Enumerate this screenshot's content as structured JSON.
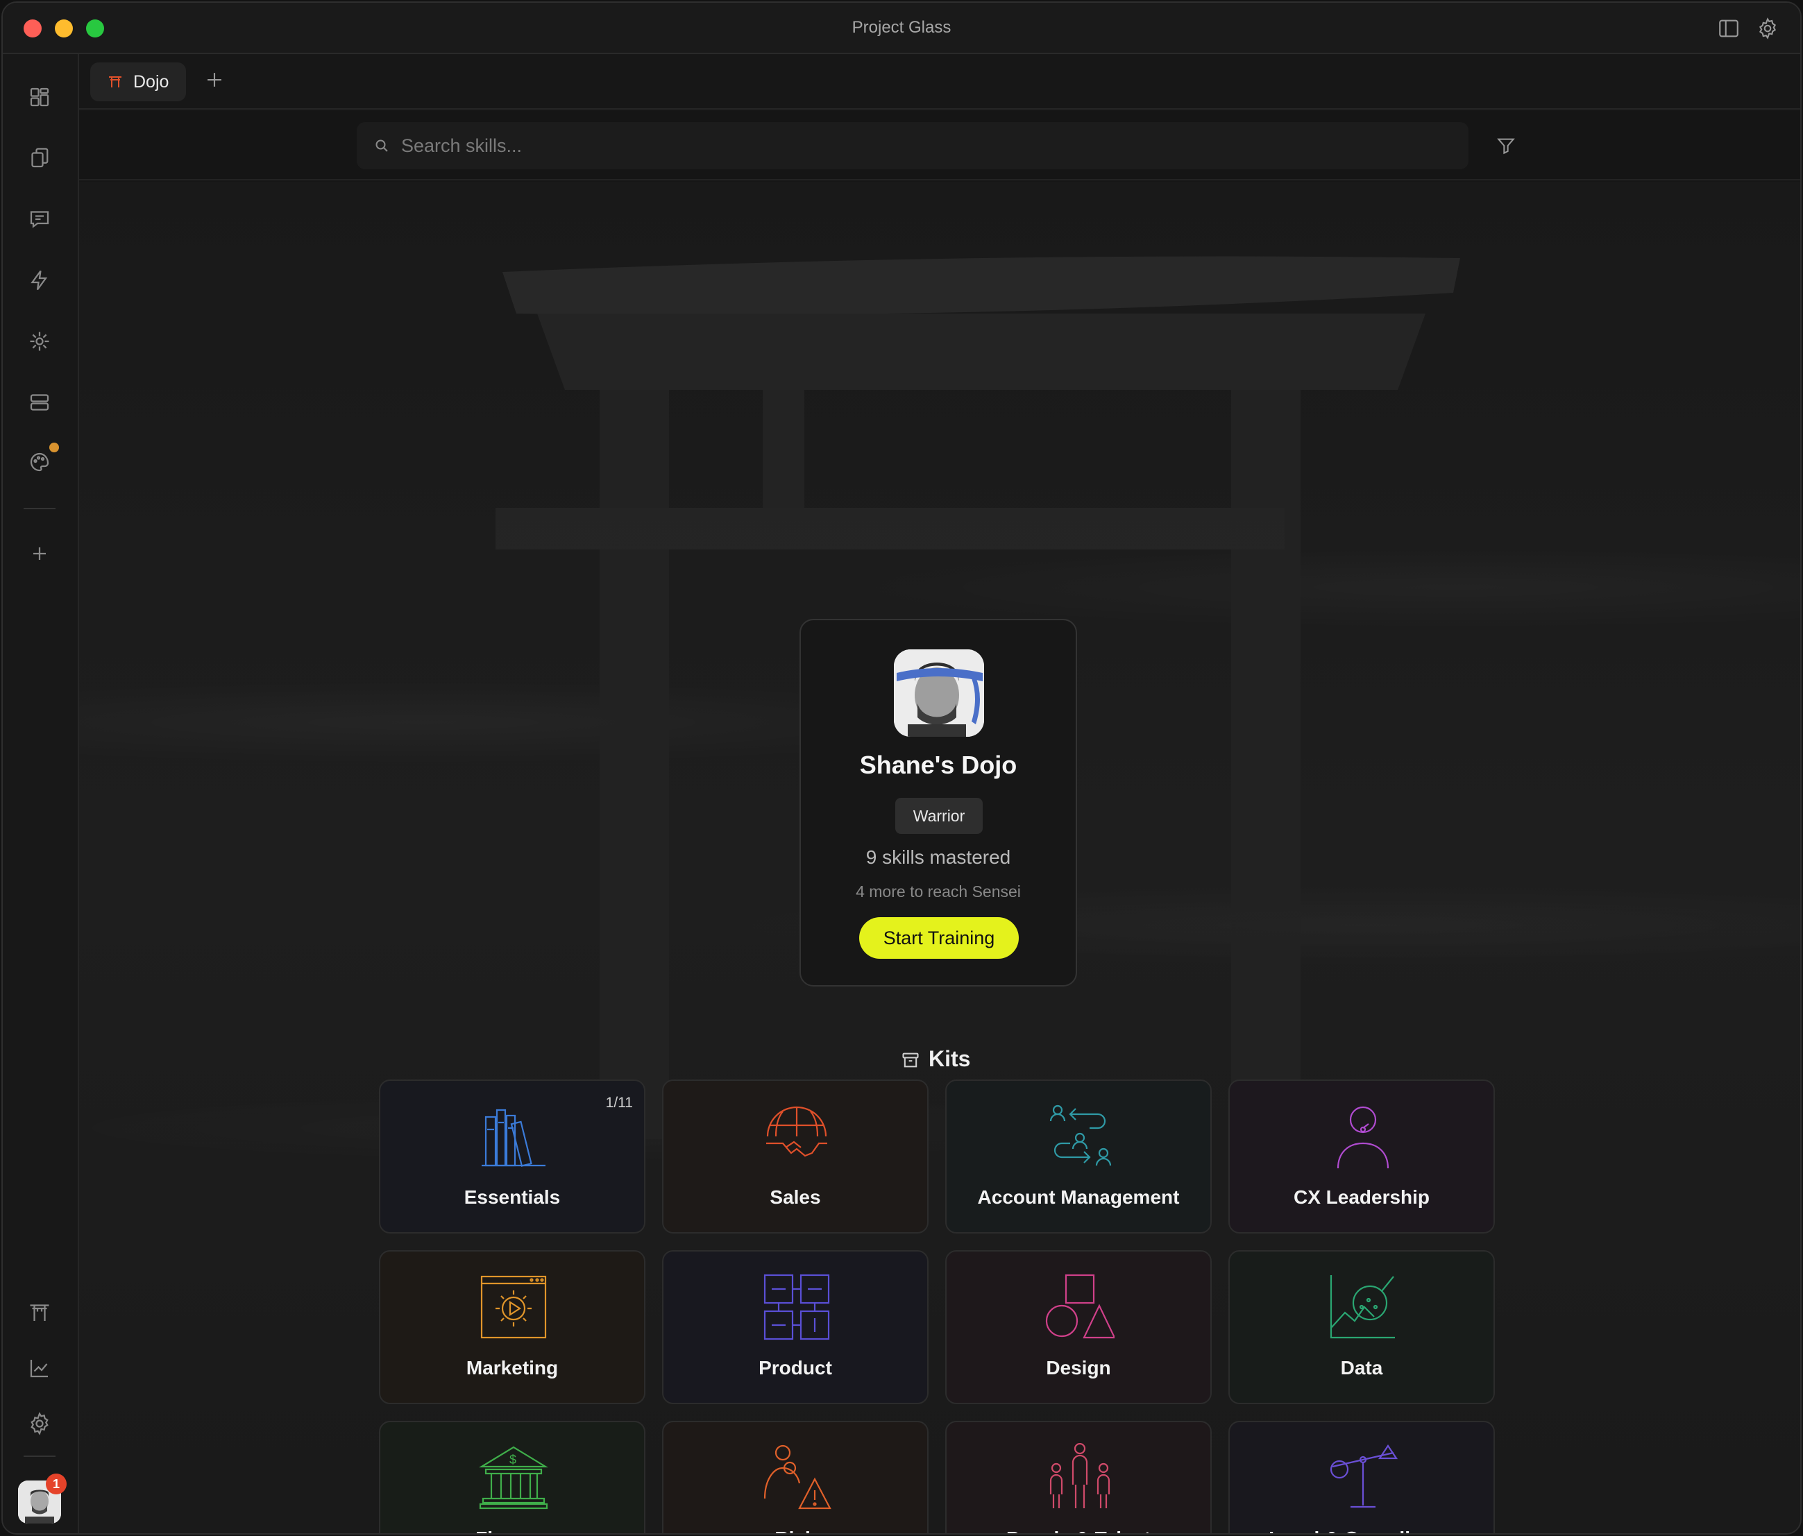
{
  "window": {
    "title": "Project Glass"
  },
  "tabs": [
    {
      "label": "Dojo",
      "icon": "torii-icon"
    }
  ],
  "search": {
    "placeholder": "Search skills..."
  },
  "profile": {
    "name": "Shane's Dojo",
    "rank": "Warrior",
    "skills_mastered": "9 skills mastered",
    "progress_note": "4 more to reach Sensei",
    "cta": "Start Training",
    "cta_color": "#e4f21c"
  },
  "kits": {
    "title": "Kits",
    "items": [
      {
        "label": "Essentials",
        "count": "1/11",
        "icon": "books-icon",
        "color": "#3b7bd8"
      },
      {
        "label": "Sales",
        "icon": "globe-handshake-icon",
        "color": "#e0502a"
      },
      {
        "label": "Account Management",
        "icon": "people-exchange-icon",
        "color": "#2f9aa6"
      },
      {
        "label": "CX Leadership",
        "icon": "headset-person-icon",
        "color": "#b04bd0"
      },
      {
        "label": "Marketing",
        "icon": "video-browser-icon",
        "color": "#e0952a"
      },
      {
        "label": "Product",
        "icon": "blocks-icon",
        "color": "#5a4fd6"
      },
      {
        "label": "Design",
        "icon": "shapes-icon",
        "color": "#d0408a"
      },
      {
        "label": "Data",
        "icon": "chart-magnifier-icon",
        "color": "#2aa672"
      },
      {
        "label": "Finance",
        "icon": "bank-icon",
        "color": "#3fae4a"
      },
      {
        "label": "Risk",
        "icon": "person-warning-icon",
        "color": "#e0602a"
      },
      {
        "label": "People & Talent",
        "icon": "group-icon",
        "color": "#d04a6a"
      },
      {
        "label": "Legal & Compliance",
        "icon": "scales-icon",
        "color": "#6a4fd6"
      }
    ]
  },
  "sidebar": {
    "items": [
      "dashboard-icon",
      "documents-icon",
      "chat-icon",
      "bolt-icon",
      "sparkle-icon",
      "storage-icon",
      "palette-icon",
      "add-icon"
    ],
    "bottom": [
      "torii-icon",
      "chart-icon",
      "settings-icon"
    ],
    "notification_count": "1"
  }
}
